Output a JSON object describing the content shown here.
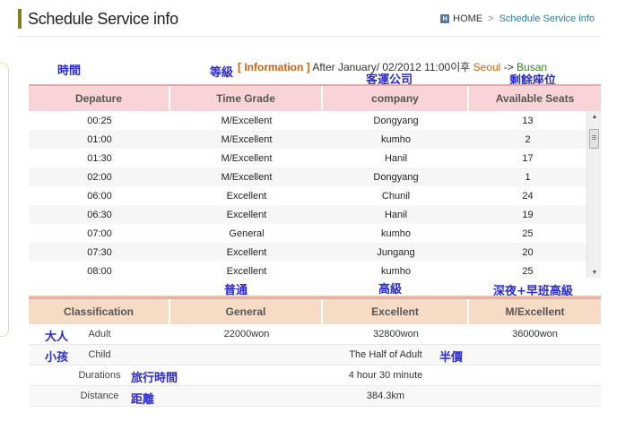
{
  "header": {
    "page_title": "Schedule Service info",
    "breadcrumb_home": "HOME",
    "breadcrumb_sep": ">",
    "breadcrumb_current": "Schedule Service info"
  },
  "info": {
    "label": "[ Information ]",
    "text": "After January/ 02/2012 11:00이후",
    "from": "Seoul",
    "arrow": "->",
    "to": "Busan"
  },
  "annotations": {
    "time": "時間",
    "grade": "等級",
    "company": "客運公司",
    "seats": "剩餘座位",
    "general": "普通",
    "excellent": "高級",
    "m_excellent": "深夜+早班高級",
    "adult": "大人",
    "child": "小孩",
    "half": "半價",
    "duration": "旅行時間",
    "distance": "距離"
  },
  "schedule": {
    "headers": [
      "Depature",
      "Time Grade",
      "company",
      "Available Seats"
    ],
    "rows": [
      [
        "00:25",
        "M/Excellent",
        "Dongyang",
        "13"
      ],
      [
        "01:00",
        "M/Excellent",
        "kumho",
        "2"
      ],
      [
        "01:30",
        "M/Excellent",
        "Hanil",
        "17"
      ],
      [
        "02:00",
        "M/Excellent",
        "Dongyang",
        "1"
      ],
      [
        "06:00",
        "Excellent",
        "Chunil",
        "24"
      ],
      [
        "06:30",
        "Excellent",
        "Hanil",
        "19"
      ],
      [
        "07:00",
        "General",
        "kumho",
        "25"
      ],
      [
        "07:30",
        "Excellent",
        "Jungang",
        "20"
      ],
      [
        "08:00",
        "Excellent",
        "kumho",
        "25"
      ]
    ]
  },
  "fares": {
    "headers": [
      "Classification",
      "General",
      "Excellent",
      "M/Excellent"
    ],
    "adult_label": "Adult",
    "adult_general": "22000won",
    "adult_excellent": "32800won",
    "adult_m_excellent": "36000won",
    "child_label": "Child",
    "child_value": "The Half of Adult",
    "duration_label": "Durations",
    "duration_value": "4 hour 30 minute",
    "distance_label": "Distance",
    "distance_value": "384.3km"
  }
}
